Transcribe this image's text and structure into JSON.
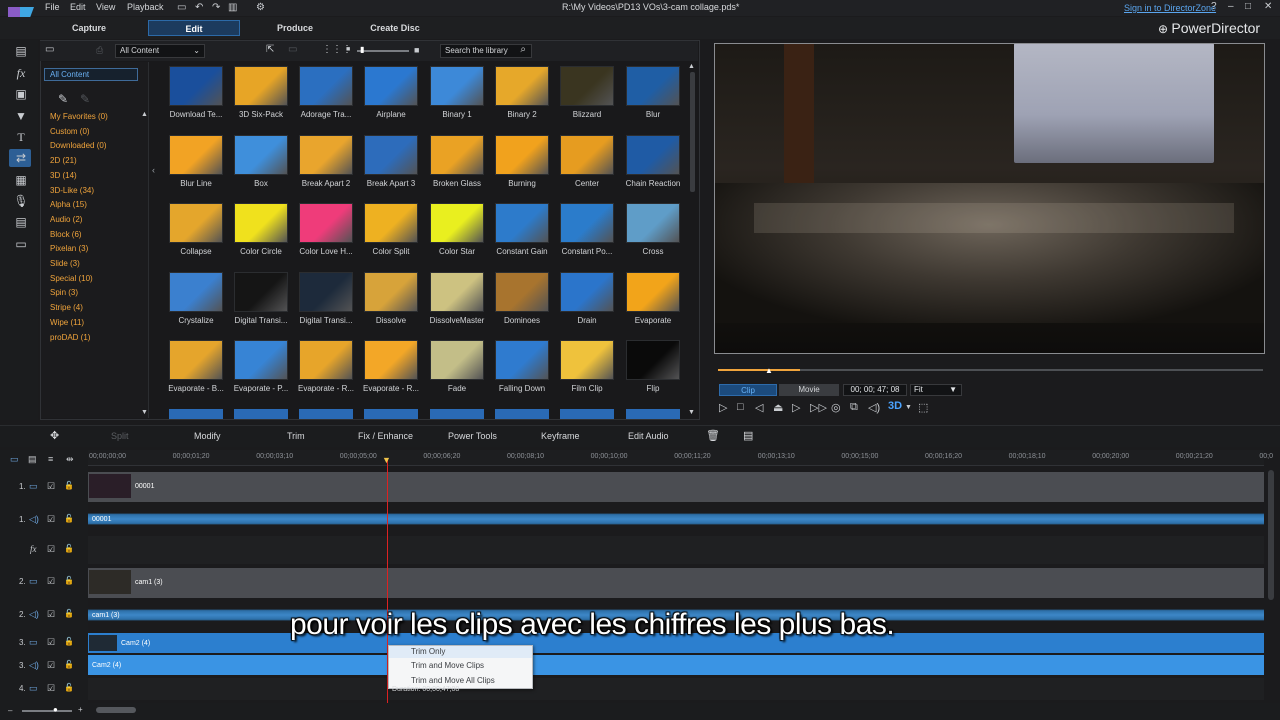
{
  "menu": {
    "file": "File",
    "edit": "Edit",
    "view": "View",
    "playback": "Playback"
  },
  "window": {
    "title": "R:\\My Videos\\PD13 VOs\\3-cam collage.pds*",
    "sign_in": "Sign in to DirectorZone",
    "brand": "PowerDirector",
    "help": "?",
    "minimize": "–",
    "maximize": "□",
    "close": "✕"
  },
  "modes": {
    "capture": "Capture",
    "edit": "Edit",
    "produce": "Produce",
    "create_disc": "Create Disc"
  },
  "library": {
    "filter": "All Content",
    "search_placeholder": "Search the library",
    "categories": {
      "all": "All Content",
      "items": [
        "My Favorites  (0)",
        "Custom  (0)",
        "Downloaded  (0)",
        "2D  (21)",
        "3D  (14)",
        "3D-Like  (34)",
        "Alpha  (15)",
        "Audio  (2)",
        "Block  (6)",
        "Pixelan  (3)",
        "Slide  (3)",
        "Special  (10)",
        "Spin  (3)",
        "Stripe  (4)",
        "Wipe  (11)",
        "proDAD  (1)"
      ]
    },
    "transitions": [
      [
        "Download Te...",
        "3D Six-Pack",
        "Adorage Tra...",
        "Airplane",
        "Binary 1",
        "Binary 2",
        "Blizzard",
        "Blur"
      ],
      [
        "Blur Line",
        "Box",
        "Break Apart 2",
        "Break Apart 3",
        "Broken Glass",
        "Burning",
        "Center",
        "Chain Reaction"
      ],
      [
        "Collapse",
        "Color Circle",
        "Color Love H...",
        "Color Split",
        "Color Star",
        "Constant Gain",
        "Constant Po...",
        "Cross"
      ],
      [
        "Crystalize",
        "Digital Transi...",
        "Digital Transi...",
        "Dissolve",
        "DissolveMaster",
        "Dominoes",
        "Drain",
        "Evaporate"
      ],
      [
        "Evaporate - B...",
        "Evaporate - P...",
        "Evaporate - R...",
        "Evaporate - R...",
        "Fade",
        "Falling Down",
        "Film Clip",
        "Flip"
      ]
    ],
    "thumb_colors": [
      [
        "#1a4f9c",
        "#e7a526",
        "#2b6fc0",
        "#2b78d0",
        "#3d89d8",
        "#e6a82a",
        "#3a3520",
        "#1f5ea5"
      ],
      [
        "#f2a324",
        "#3f8fdb",
        "#e9a52d",
        "#2d6cbb",
        "#eaa224",
        "#f1a21d",
        "#e69c20",
        "#1f5ba5"
      ],
      [
        "#e4a62c",
        "#f0e11d",
        "#ef3c7a",
        "#eeb121",
        "#e9ef1f",
        "#2d7bcb",
        "#2b7ccb",
        "#5f9dc8"
      ],
      [
        "#3b80cf",
        "#151515",
        "#1d2a3b",
        "#d7a33a",
        "#cdc281",
        "#a8742e",
        "#2b75cb",
        "#f2a41a"
      ],
      [
        "#e5a52c",
        "#3784d5",
        "#e7a52a",
        "#f3a727",
        "#c3be88",
        "#2f7bcf",
        "#efc23c",
        "#0a0a0a"
      ]
    ]
  },
  "preview": {
    "clip": "Clip",
    "movie": "Movie",
    "timecode": "00; 00; 47; 08",
    "fit": "Fit",
    "progress": 0.15,
    "mode_3d": "3D"
  },
  "edit_toolbar": {
    "split": "Split",
    "modify": "Modify",
    "trim": "Trim",
    "fix_enhance": "Fix / Enhance",
    "power_tools": "Power Tools",
    "keyframe": "Keyframe",
    "edit_audio": "Edit Audio"
  },
  "ruler": [
    "00;00;00;00",
    "00;00;01;20",
    "00;00;03;10",
    "00;00;05;00",
    "00;00;06;20",
    "00;00;08;10",
    "00;00;10;00",
    "00;00;11;20",
    "00;00;13;10",
    "00;00;15;00",
    "00;00;16;20",
    "00;00;18;10",
    "00;00;20;00",
    "00;00;21;20",
    "00;0"
  ],
  "tracks": {
    "t1v": {
      "num": "1.",
      "clip": "00001"
    },
    "t1a": {
      "num": "1.",
      "clip": "00001"
    },
    "t2v": {
      "num": "2.",
      "clip": "cam1 (3)"
    },
    "t2a": {
      "num": "2.",
      "clip": "cam1 (3)"
    },
    "t3v": {
      "num": "3.",
      "clip": "Cam2 (4)"
    },
    "t3a": {
      "num": "3.",
      "clip": "Cam2 (4)"
    },
    "t4v": {
      "num": "4."
    }
  },
  "context_menu": {
    "trim_only": "Trim Only",
    "trim_move": "Trim and Move Clips",
    "trim_move_all": "Trim and Move All Clips",
    "duration": "Duration: 00;00;47;08"
  },
  "subtitle": "pour voir les clips avec les chiffres les plus bas."
}
